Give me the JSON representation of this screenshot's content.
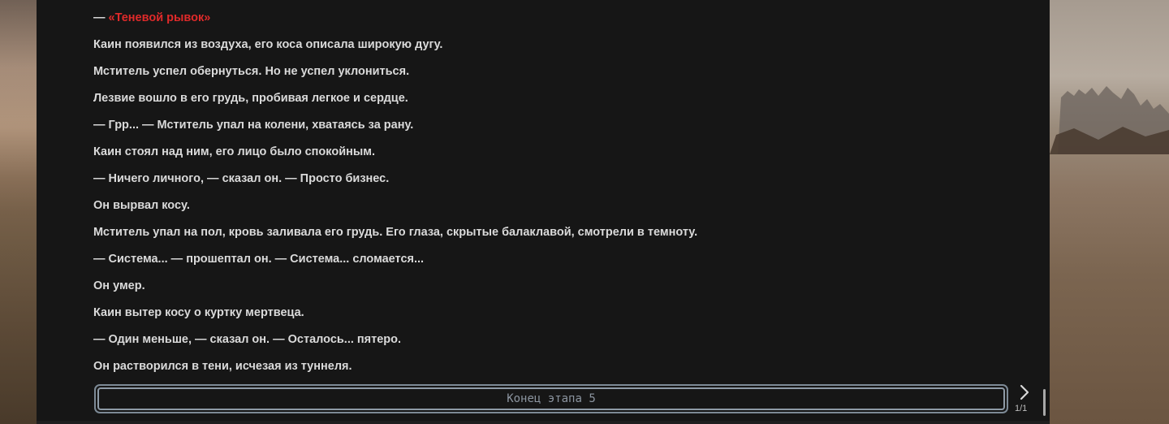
{
  "story": {
    "skill_prefix": "— ",
    "skill_name": "«Теневой рывок»",
    "paragraphs": [
      "Каин появился из воздуха, его коса описала широкую дугу.",
      "Мститель успел обернуться. Но не успел уклониться.",
      "Лезвие вошло в его грудь, пробивая легкое и сердце.",
      "— Грр... — Мститель упал на колени, хватаясь за рану.",
      "Каин стоял над ним, его лицо было спокойным.",
      "— Ничего личного, — сказал он. — Просто бизнес.",
      "Он вырвал косу.",
      "Мститель упал на пол, кровь заливала его грудь. Его глаза, скрытые балаклавой, смотрели в темноту.",
      "— Система... — прошептал он. — Система... сломается...",
      "Он умер.",
      "Каин вытер косу о куртку мертвеца.",
      "— Один меньше, — сказал он. — Осталось... пятеро.",
      "Он растворился в тени, исчезая из туннеля."
    ]
  },
  "footer": {
    "end_label": "Конец этапа 5",
    "page_counter": "1/1",
    "next_icon": "chevron-right-icon"
  },
  "colors": {
    "reader_bg": "#161616",
    "text": "#dadada",
    "accent_red": "#e02a2a",
    "button_border": "#8e9aa6"
  }
}
